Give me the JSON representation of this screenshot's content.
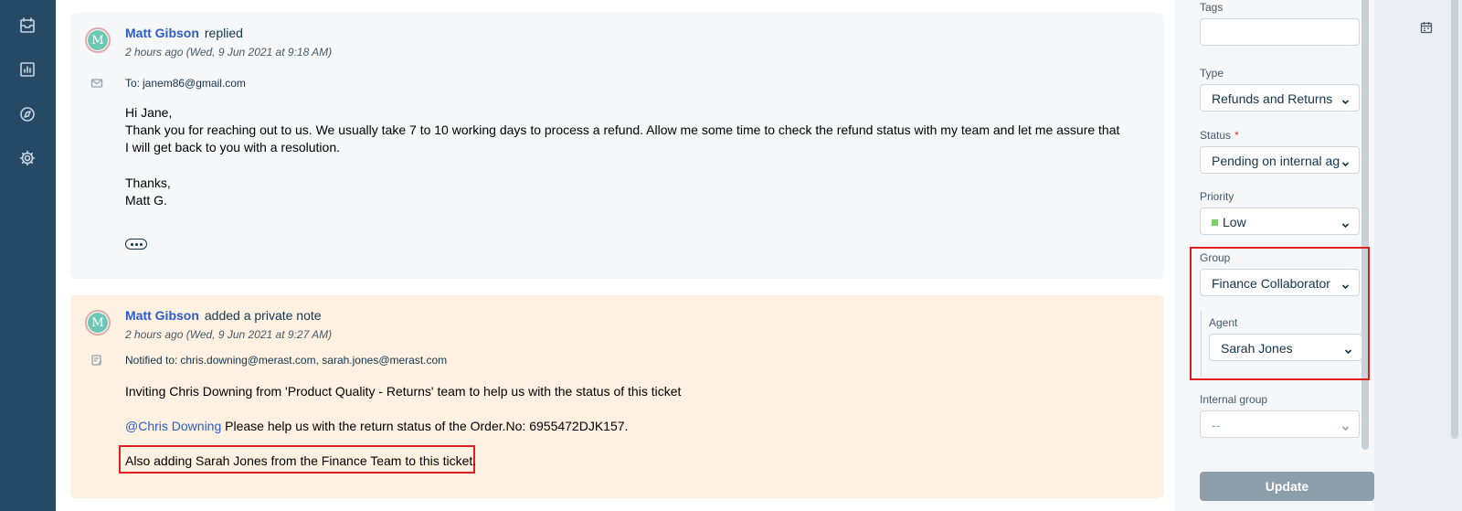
{
  "nav": {
    "items": [
      {
        "name": "tickets-icon"
      },
      {
        "name": "reports-icon"
      },
      {
        "name": "explore-icon"
      },
      {
        "name": "settings-icon"
      }
    ]
  },
  "conversation": {
    "reply": {
      "avatar_initial": "M",
      "author": "Matt Gibson",
      "action": "replied",
      "time": "2 hours ago (Wed, 9 Jun 2021 at 9:18 AM)",
      "to_label": "To:",
      "to_value": "janem86@gmail.com",
      "body_lines": [
        "Hi Jane,",
        "Thank you for reaching out to us. We usually take 7 to 10 working days to process a refund. Allow me some time to check the refund status with my team and let me assure that I will get back to you with a resolution.",
        "Thanks,",
        "Matt G."
      ]
    },
    "note": {
      "avatar_initial": "M",
      "author": "Matt Gibson",
      "action": "added a private note",
      "time": "2 hours ago (Wed, 9 Jun 2021 at 9:27 AM)",
      "notified_label": "Notified to:",
      "notified_value": "chris.downing@merast.com, sarah.jones@merast.com",
      "line1": "Inviting Chris Downing from 'Product Quality - Returns' team to help us with the status of this ticket",
      "mention": "@Chris Downing",
      "line2_rest": " Please help us with the return status of the Order.No: 6955472DJK157.",
      "line3": "Also adding Sarah Jones from the Finance Team to this ticket."
    }
  },
  "properties": {
    "tags_label": "Tags",
    "tags_value": "",
    "type_label": "Type",
    "type_value": "Refunds and Returns",
    "status_label": "Status",
    "status_required": "*",
    "status_value": "Pending on internal ag",
    "priority_label": "Priority",
    "priority_value": "Low",
    "priority_color": "#7ed06a",
    "group_label": "Group",
    "group_value": "Finance Collaborator",
    "agent_label": "Agent",
    "agent_value": "Sarah Jones",
    "internal_group_label": "Internal group",
    "internal_group_value": "--",
    "update_label": "Update"
  },
  "rightbar": {
    "icon": "calendar-icon"
  }
}
